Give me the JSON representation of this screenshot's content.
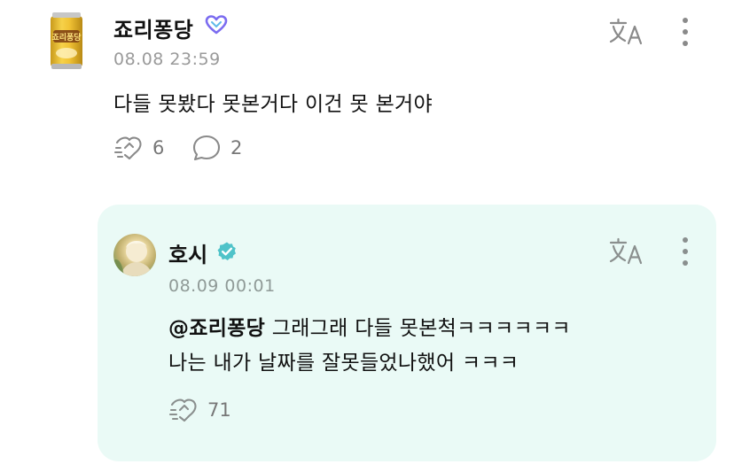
{
  "post": {
    "author": "죠리퐁당",
    "timestamp": "08.08 23:59",
    "text": "다들 못봤다 못본거다 이건 못 본거야",
    "avatar_label": "죠리퐁당",
    "likes": "6",
    "comments": "2",
    "icons": [
      "heart-badge-icon",
      "translate-icon",
      "more-vertical-icon",
      "like-icon",
      "comment-icon"
    ]
  },
  "reply": {
    "author": "호시",
    "timestamp": "08.09 00:01",
    "mention": "@죠리퐁당",
    "text_line1": " 그래그래 다들 못본척ㅋㅋㅋㅋㅋㅋ",
    "text_line2": "나는 내가 날짜를 잘못들었나했어 ㅋㅋㅋ",
    "likes": "71",
    "icons": [
      "verified-icon",
      "translate-icon",
      "more-vertical-icon",
      "like-icon"
    ]
  },
  "colors": {
    "reply_background": "#eafaf6",
    "verified": "#4fc3c9",
    "heart_badge": "#7b6cf0",
    "muted_text": "#9a9a9a"
  }
}
